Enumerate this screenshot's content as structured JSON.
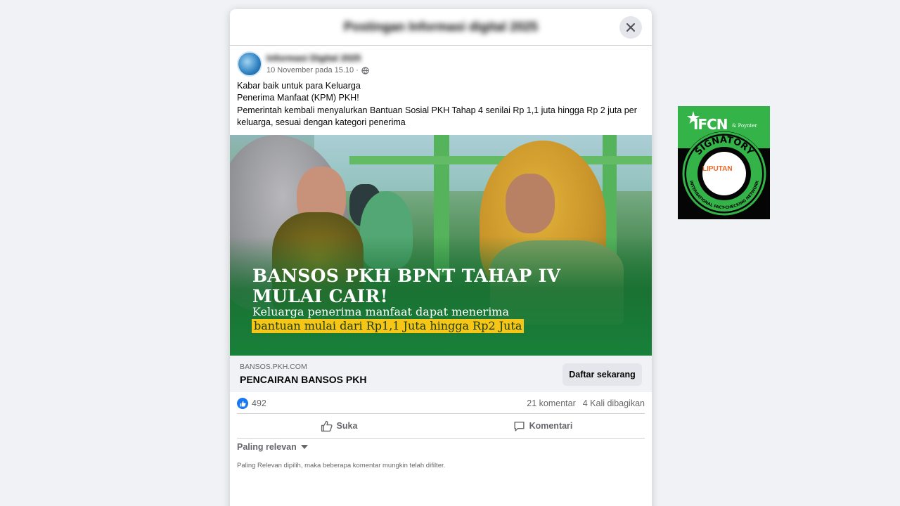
{
  "modal": {
    "title": "Postingan Informasi digital 2025",
    "close_icon": "close-icon"
  },
  "post": {
    "page_name": "Informasi Digital 2025",
    "time": "10 November pada 15.10",
    "audience_icon": "globe-icon",
    "text_lines": [
      "Kabar baik untuk para Keluarga",
      "Penerima Manfaat (KPM) PKH!",
      "Pemerintah kembali menyalurkan Bantuan Sosial PKH Tahap 4 senilai Rp 1,1 juta hingga Rp 2 juta per keluarga, sesuai dengan kategori penerima"
    ]
  },
  "image": {
    "headline_line1": "BANSOS PKH BPNT TAHAP IV",
    "headline_line2": "MULAI CAIR!",
    "subline": "Keluarga penerima manfaat dapat menerima",
    "highlight": "bantuan mulai dari Rp1,1 Juta hingga Rp2 Juta",
    "colors": {
      "green": "#18813a",
      "highlight": "#f5c518"
    }
  },
  "link": {
    "domain": "BANSOS.PKH.COM",
    "title": "PENCAIRAN BANSOS PKH",
    "cta": "Daftar sekarang"
  },
  "stats": {
    "reactions": "492",
    "comments": "21 komentar",
    "shares": "4 Kali dibagikan"
  },
  "actions": {
    "like": "Suka",
    "comment": "Komentari"
  },
  "sort": {
    "label": "Paling relevan",
    "note": "Paling Relevan dipilih, maka beberapa komentar mungkin telah difilter."
  },
  "badge": {
    "logo": "IFCN",
    "poynter": "& Poynter",
    "ring_top": "SIGNATORY",
    "ring_bottom": "INTERNATIONAL FACT-CHECKING NETWORK",
    "member": "LIPUTAN",
    "colors": {
      "green": "#34b349",
      "black": "#050505"
    }
  }
}
